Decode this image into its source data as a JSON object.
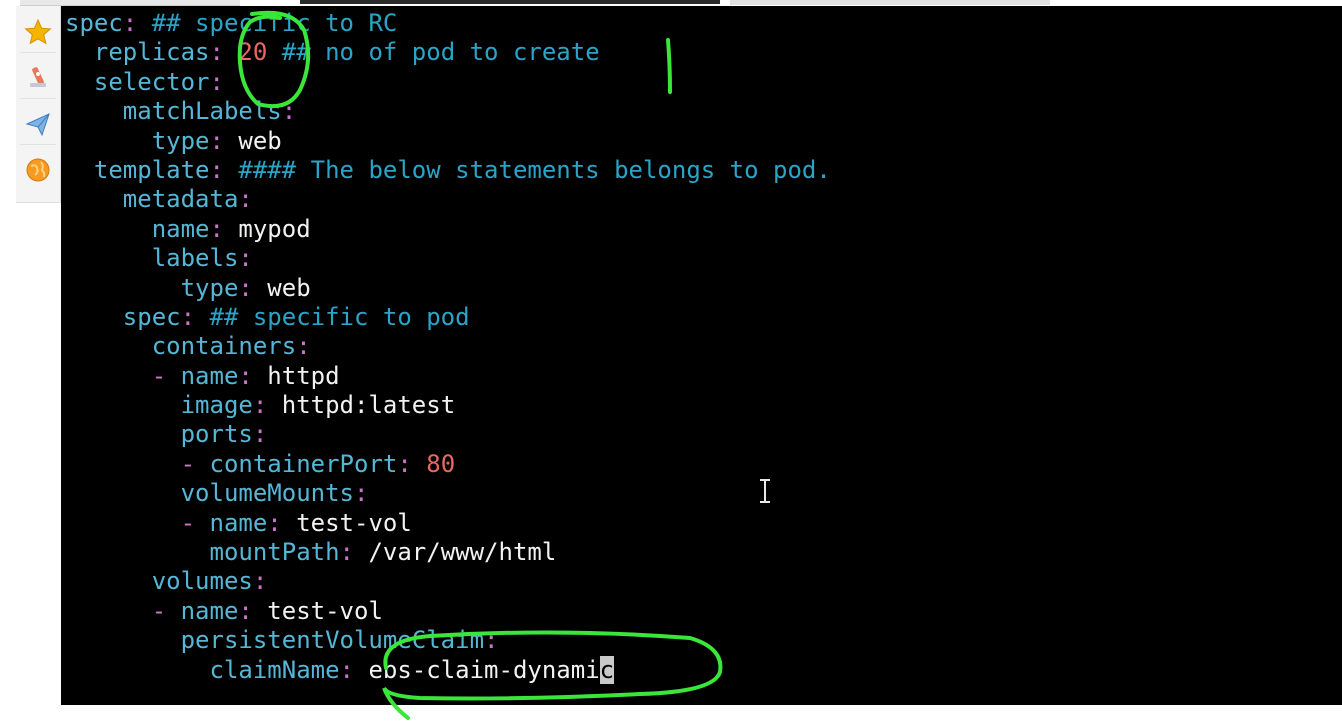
{
  "dock": {
    "icons": [
      "star-icon",
      "satellite-icon",
      "paper-plane-icon",
      "globe-icon"
    ]
  },
  "editor": {
    "lines": [
      {
        "indent": "",
        "key": "spec",
        "dash": "",
        "value": "",
        "comment": " ## specific to RC"
      },
      {
        "indent": "  ",
        "key": "replicas",
        "dash": "",
        "value": "",
        "number": "20",
        "comment": " ## no of pod to create"
      },
      {
        "indent": "  ",
        "key": "selector",
        "dash": "",
        "value": "",
        "comment": ""
      },
      {
        "indent": "    ",
        "key": "matchLabels",
        "dash": "",
        "value": "",
        "comment": ""
      },
      {
        "indent": "      ",
        "key": "type",
        "dash": "",
        "value": " web",
        "comment": ""
      },
      {
        "indent": "  ",
        "key": "template",
        "dash": "",
        "value": "",
        "comment": " #### The below statements belongs to pod."
      },
      {
        "indent": "    ",
        "key": "metadata",
        "dash": "",
        "value": "",
        "comment": ""
      },
      {
        "indent": "      ",
        "key": "name",
        "dash": "",
        "value": " mypod",
        "comment": ""
      },
      {
        "indent": "      ",
        "key": "labels",
        "dash": "",
        "value": "",
        "comment": ""
      },
      {
        "indent": "        ",
        "key": "type",
        "dash": "",
        "value": " web",
        "comment": ""
      },
      {
        "indent": "    ",
        "key": "spec",
        "dash": "",
        "value": "",
        "comment": " ## specific to pod"
      },
      {
        "indent": "      ",
        "key": "containers",
        "dash": "",
        "value": "",
        "comment": ""
      },
      {
        "indent": "      ",
        "key": "name",
        "dash": "- ",
        "value": " httpd",
        "comment": ""
      },
      {
        "indent": "        ",
        "key": "image",
        "dash": "",
        "value": " httpd:latest",
        "comment": ""
      },
      {
        "indent": "        ",
        "key": "ports",
        "dash": "",
        "value": "",
        "comment": ""
      },
      {
        "indent": "        ",
        "key": "containerPort",
        "dash": "- ",
        "value": "",
        "number": "80",
        "comment": ""
      },
      {
        "indent": "        ",
        "key": "volumeMounts",
        "dash": "",
        "value": "",
        "comment": ""
      },
      {
        "indent": "        ",
        "key": "name",
        "dash": "- ",
        "value": " test-vol",
        "comment": ""
      },
      {
        "indent": "          ",
        "key": "mountPath",
        "dash": "",
        "value": " /var/www/html",
        "comment": ""
      },
      {
        "indent": "      ",
        "key": "volumes",
        "dash": "",
        "value": "",
        "comment": ""
      },
      {
        "indent": "      ",
        "key": "name",
        "dash": "- ",
        "value": " test-vol",
        "comment": ""
      },
      {
        "indent": "        ",
        "key": "persistentVolumeClaim",
        "dash": "",
        "value": "",
        "comment": ""
      },
      {
        "indent": "          ",
        "key": "claimName",
        "dash": "",
        "value": " ebs-claim-dynami",
        "cursor": "c",
        "comment": ""
      }
    ]
  },
  "colors": {
    "key": "#56b6d6",
    "punctuation": "#c874c8",
    "comment": "#2aa4c7",
    "number": "#e8695f",
    "annotation": "#39e639",
    "editor_bg": "#000000"
  }
}
